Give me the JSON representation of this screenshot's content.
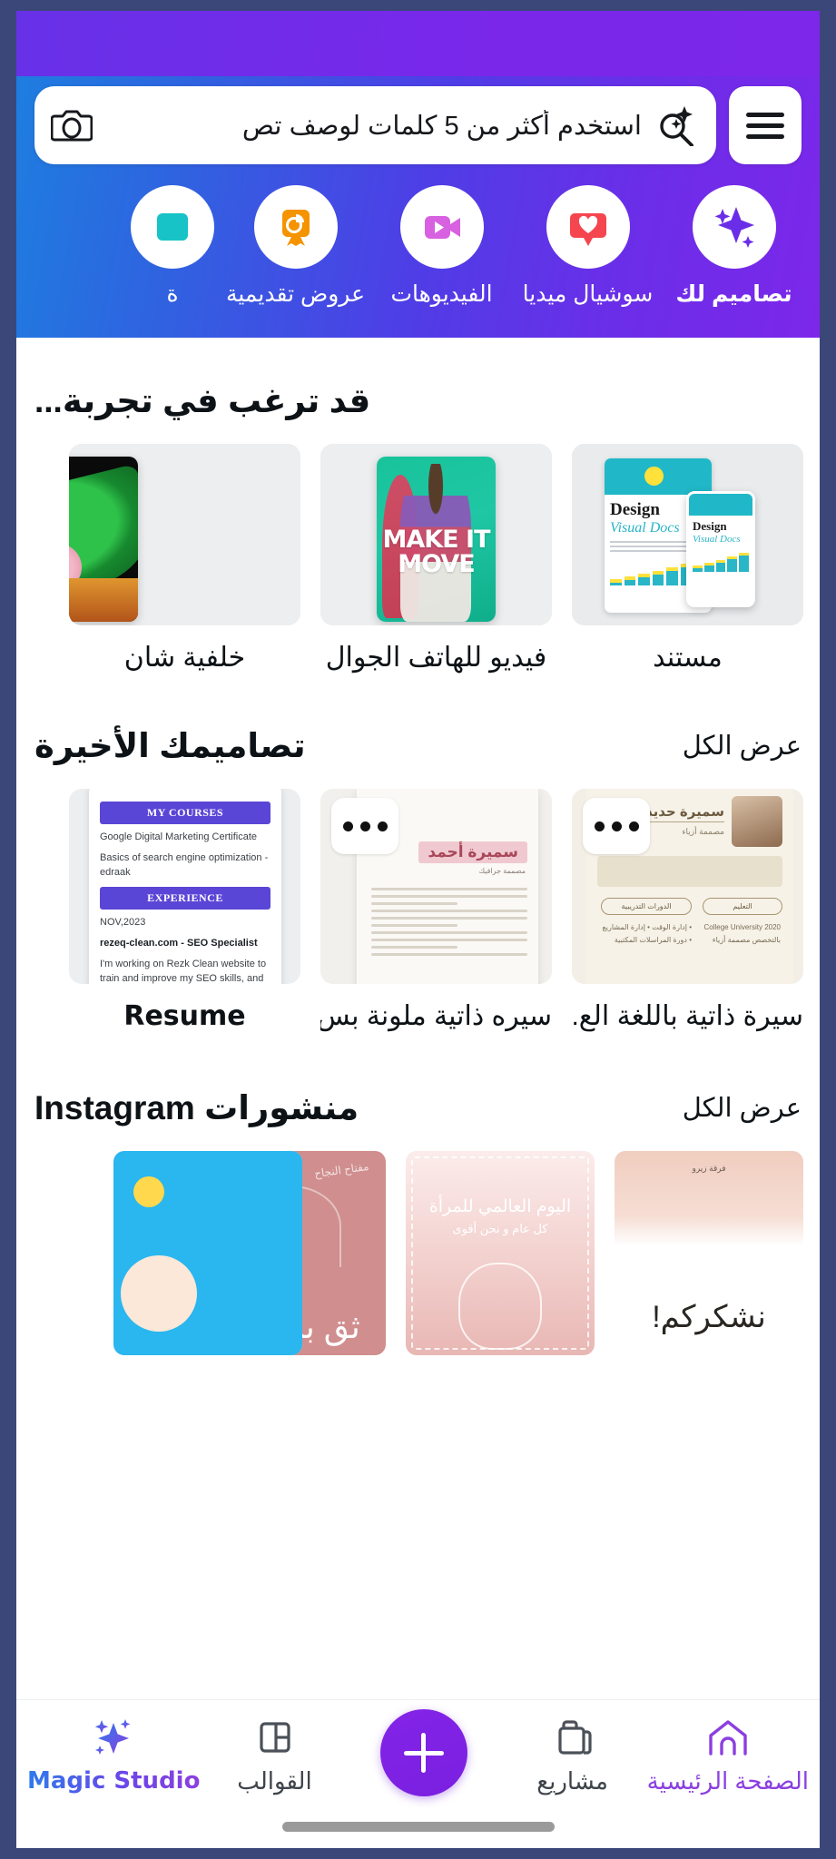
{
  "header": {
    "search_placeholder": "استخدم أكثر من 5 كلمات لوصف تص",
    "menu_icon": "hamburger-icon",
    "search_icon": "magic-search-icon",
    "camera_icon": "camera-icon"
  },
  "categories": [
    {
      "label": "تصاميم لك",
      "icon": "sparkles-icon",
      "active": true
    },
    {
      "label": "سوشيال ميديا",
      "icon": "heart-pin-icon",
      "active": false
    },
    {
      "label": "الفيديوهات",
      "icon": "video-camera-icon",
      "active": false
    },
    {
      "label": "عروض تقديمية",
      "icon": "presentation-icon",
      "active": false
    },
    {
      "label": "ة",
      "icon": "partial-icon",
      "active": false
    }
  ],
  "sections": {
    "try": {
      "title": "قد ترغب في تجربة...",
      "cards": [
        {
          "label": "مستند",
          "art": "doc"
        },
        {
          "label": "فيديو للهاتف الجوال",
          "art": "video"
        },
        {
          "label": "خلفية شان",
          "art": "green"
        }
      ]
    },
    "recent": {
      "title": "تصاميمك الأخيرة",
      "see_all": "عرض الكل",
      "cards": [
        {
          "label": "سيرة ذاتية باللغة الع...",
          "art": "beige"
        },
        {
          "label": "سيره ذاتية ملونة بس...",
          "art": "arabic"
        },
        {
          "label": "Resume",
          "art": "english"
        }
      ]
    },
    "instagram": {
      "title": "منشورات Instagram",
      "see_all": "عرض الكل",
      "cards": [
        {
          "art": "thanks",
          "text_main": "نشكركم!",
          "text_small": "فرقة زيرو"
        },
        {
          "art": "women",
          "text_main": "اليوم العالمي للمرأة",
          "text_small": "كل عام و نحن أقوى"
        },
        {
          "art": "trust",
          "text_main": "ثق بنفسك",
          "text_small": "مفتاح النجاح"
        },
        {
          "art": "blue",
          "text_main": "",
          "text_small": ""
        }
      ]
    }
  },
  "resume_english": {
    "badge1": "MY COURSES",
    "line1": "Google Digital Marketing Certificate",
    "line2": "Basics of search engine optimization - edraak",
    "badge2": "EXPERIENCE",
    "date": "NOV,2023",
    "role": "rezeq-clean.com - SEO Specialist",
    "body": "I'm working on Rezk Clean website to train and improve my SEO skills, and Writing SEO articles."
  },
  "resume_arabic": {
    "name": "سميرة أحمد",
    "subtitle": "مصممة جرافيك"
  },
  "resume_beige": {
    "name": "سميرة حديد",
    "subtitle": "مصممة أزياء",
    "pill_right": "التعليم",
    "pill_left": "الدورات التدريبية",
    "col_right": "2020\nCollege University\nبالتخصص مصممة أزياء",
    "col_left": "• إدارة الوقت\n• إدارة المشاريع\n• دورة المراسلات المكتبية"
  },
  "doc_thumb": {
    "title": "Design",
    "subtitle": "Visual Docs"
  },
  "video_thumb": {
    "line1": "MAKE IT",
    "line2": "MOVE"
  },
  "bottom_nav": [
    {
      "label": "الصفحة الرئيسية",
      "icon": "home-icon",
      "active": true,
      "style": "normal"
    },
    {
      "label": "مشاريع",
      "icon": "folder-icon",
      "active": false,
      "style": "normal"
    },
    {
      "label": "",
      "icon": "plus-icon",
      "active": false,
      "style": "fab"
    },
    {
      "label": "القوالب",
      "icon": "templates-icon",
      "active": false,
      "style": "normal"
    },
    {
      "label": "Magic Studio",
      "icon": "sparkles-icon",
      "active": false,
      "style": "gradient"
    }
  ],
  "colors": {
    "brand_purple": "#7c27ea",
    "brand_blue": "#1d7fe0",
    "accent_active": "#8b3fe0",
    "frame": "#3c4779"
  }
}
